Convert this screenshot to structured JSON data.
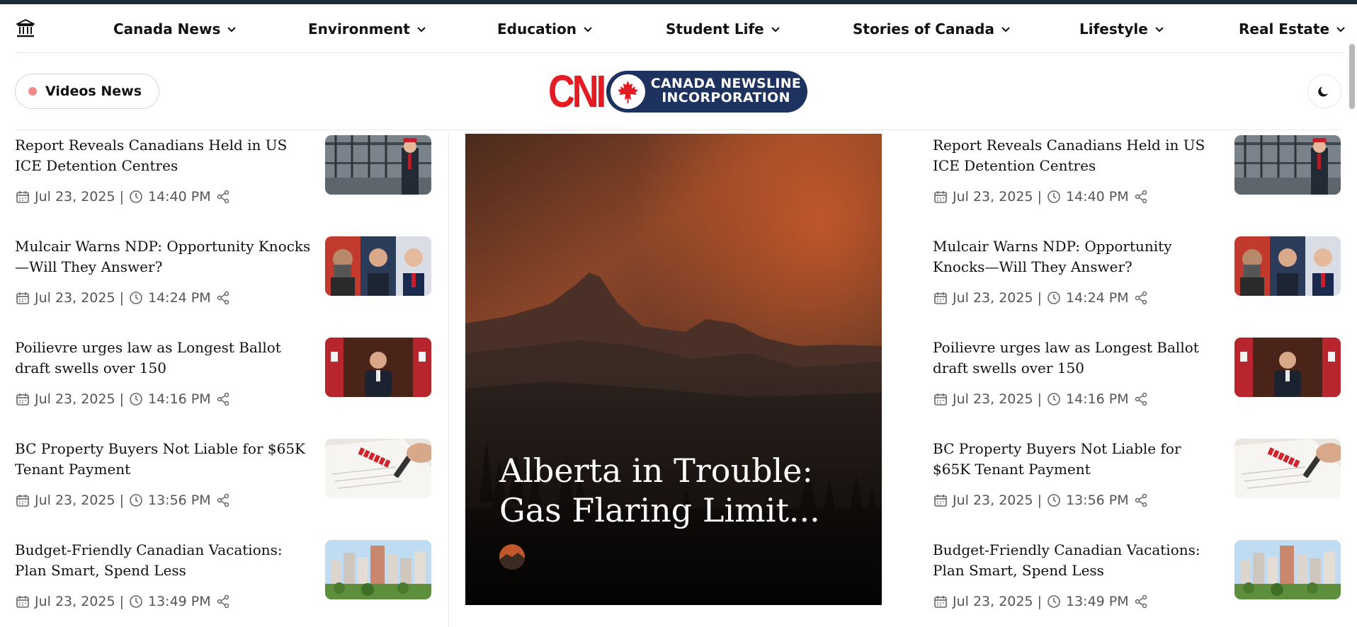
{
  "nav": {
    "home_icon": "institution-icon",
    "items": [
      {
        "label": "Canada News",
        "icon": "chevron-down-icon"
      },
      {
        "label": "Environment",
        "icon": "chevron-down-icon"
      },
      {
        "label": "Education",
        "icon": "chevron-down-icon"
      },
      {
        "label": "Student Life",
        "icon": "chevron-down-icon"
      },
      {
        "label": "Stories of Canada",
        "icon": "chevron-down-icon"
      },
      {
        "label": "Lifestyle",
        "icon": "chevron-down-icon"
      },
      {
        "label": "Real Estate",
        "icon": "chevron-down-icon"
      }
    ]
  },
  "header": {
    "videos_label": "Videos News",
    "logo_mark": "CNI",
    "logo_line1": "CANADA NEWSLINE",
    "logo_line2": "INCORPORATION",
    "dark_mode_icon": "moon-icon"
  },
  "colors": {
    "brand_red": "#e31b23",
    "brand_navy": "#1e3260",
    "live_dot": "#f08a8a"
  },
  "left_articles": [
    {
      "title": "Report Reveals Canadians Held in US ICE Detention Centres",
      "date": "Jul 23, 2025",
      "time": "14:40 PM"
    },
    {
      "title": "Mulcair Warns NDP: Opportunity Knocks—Will They Answer?",
      "date": "Jul 23, 2025",
      "time": "14:24 PM"
    },
    {
      "title": "Poilievre urges law as Longest Ballot draft swells over 150",
      "date": "Jul 23, 2025",
      "time": "14:16 PM"
    },
    {
      "title": "BC Property Buyers Not Liable for $65K Tenant Payment",
      "date": "Jul 23, 2025",
      "time": "13:56 PM"
    },
    {
      "title": "Budget-Friendly Canadian Vacations: Plan Smart, Spend Less",
      "date": "Jul 23, 2025",
      "time": "13:49 PM"
    }
  ],
  "right_articles": [
    {
      "title": "Report Reveals Canadians Held in US ICE Detention Centres",
      "date": "Jul 23, 2025",
      "time": "14:40 PM"
    },
    {
      "title": "Mulcair Warns NDP: Opportunity Knocks—Will They Answer?",
      "date": "Jul 23, 2025",
      "time": "14:24 PM"
    },
    {
      "title": "Poilievre urges law as Longest Ballot draft swells over 150",
      "date": "Jul 23, 2025",
      "time": "14:16 PM"
    },
    {
      "title": "BC Property Buyers Not Liable for $65K Tenant Payment",
      "date": "Jul 23, 2025",
      "time": "13:56 PM"
    },
    {
      "title": "Budget-Friendly Canadian Vacations: Plan Smart, Spend Less",
      "date": "Jul 23, 2025",
      "time": "13:49 PM"
    }
  ],
  "hero": {
    "title": "Alberta in Trouble: Gas Flaring Limit..."
  }
}
